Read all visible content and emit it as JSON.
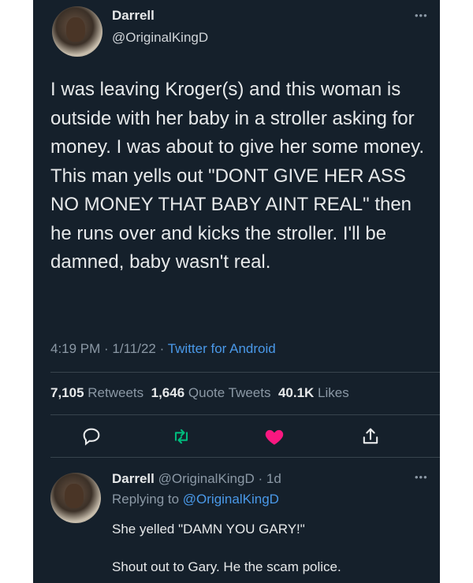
{
  "author": {
    "display_name": "Darrell",
    "handle": "@OriginalKingD"
  },
  "tweet": {
    "text": "I was leaving Kroger(s) and this woman is outside with her baby in a stroller asking for money. I was about to give her some money. This man yells out \"DONT GIVE HER ASS NO MONEY THAT BABY AINT REAL\" then he runs over and kicks the stroller. I'll be damned, baby wasn't real.",
    "time": "4:19 PM",
    "date": "1/11/22",
    "source": "Twitter for Android",
    "separator": " · "
  },
  "stats": {
    "retweets_count": "7,105",
    "retweets_label": "Retweets",
    "quote_count": "1,646",
    "quote_label": "Quote Tweets",
    "likes_count": "40.1K",
    "likes_label": "Likes"
  },
  "actions": {
    "reply_icon": "reply-icon",
    "retweet_icon": "retweet-icon",
    "like_icon": "heart-icon",
    "share_icon": "share-icon"
  },
  "reply": {
    "display_name": "Darrell",
    "handle": "@OriginalKingD",
    "age": "1d",
    "dot": " · ",
    "replying_prefix": "Replying to ",
    "replying_to": "@OriginalKingD",
    "text": "She yelled \"DAMN YOU GARY!\"\n\nShout out to Gary. He the scam police."
  },
  "more_icon": "•••",
  "colors": {
    "background": "#15202b",
    "accent": "#4a99e9",
    "like": "#f91880",
    "retweet": "#00ba7c",
    "secondary_text": "#8b98a5"
  }
}
